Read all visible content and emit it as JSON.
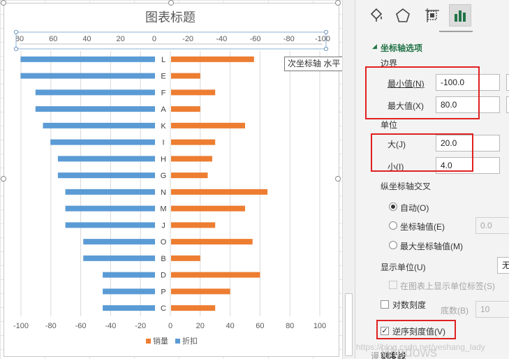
{
  "chart_data": {
    "type": "bar",
    "orientation": "horizontal",
    "title": "图表标题",
    "categories": [
      "L",
      "E",
      "F",
      "A",
      "K",
      "I",
      "H",
      "G",
      "N",
      "M",
      "J",
      "O",
      "B",
      "D",
      "P",
      "C"
    ],
    "series": [
      {
        "name": "销量",
        "values": [
          56,
          20,
          30,
          20,
          50,
          30,
          28,
          25,
          65,
          50,
          30,
          55,
          20,
          60,
          40,
          30
        ],
        "color": "#ED7D31"
      },
      {
        "name": "折扣",
        "values": [
          -90,
          -90,
          -80,
          -80,
          -75,
          -70,
          -65,
          -65,
          -60,
          -60,
          -60,
          -48,
          -48,
          -35,
          -35,
          -35
        ],
        "color": "#5B9BD5"
      }
    ],
    "primary_x_axis": {
      "min": -100,
      "max": 100,
      "ticks": [
        "-100",
        "-80",
        "-60",
        "-40",
        "-20",
        "0",
        "20",
        "40",
        "60",
        "80",
        "100"
      ]
    },
    "secondary_x_axis": {
      "min": -100,
      "max": 80,
      "reversed": true,
      "ticks": [
        "80",
        "60",
        "40",
        "20",
        "0",
        "-20",
        "-40",
        "-60",
        "-80",
        "-100"
      ]
    },
    "legend_position": "bottom",
    "grid": true
  },
  "tooltip": "次坐标轴 水平 (值) 轴",
  "pane": {
    "tabs": [
      "fill-icon",
      "effects-icon",
      "size-icon",
      "bar-chart-icon"
    ],
    "section_title": "坐标轴选项",
    "bounds_heading": "边界",
    "min_label": "最小值(N)",
    "min_value": "-100.0",
    "max_label": "最大值(X)",
    "max_value": "80.0",
    "units_heading": "单位",
    "major_label": "大(J)",
    "major_value": "20.0",
    "minor_label": "小(I)",
    "minor_value": "4.0",
    "cross_heading": "纵坐标轴交叉",
    "auto_label": "自动(O)",
    "axis_value_label": "坐标轴值(E)",
    "axis_value": "0.0",
    "max_axis_label": "最大坐标轴值(M)",
    "display_units_label": "显示单位(U)",
    "display_units_value": "无",
    "show_units_label": "在图表上显示单位标签(S)",
    "log_scale_label": "对数刻度",
    "base_label": "底数(B)",
    "base_value": "10",
    "reverse_label": "逆序刻度值(V)",
    "tick_marks_label": "刻度线",
    "values_heading_partial": "谩"
  },
  "watermark": "https://blog.csdn.net/yeshang_lady",
  "os_watermark": "Windows",
  "colors": {
    "accent": "#217346",
    "highlight": "#E02020"
  }
}
